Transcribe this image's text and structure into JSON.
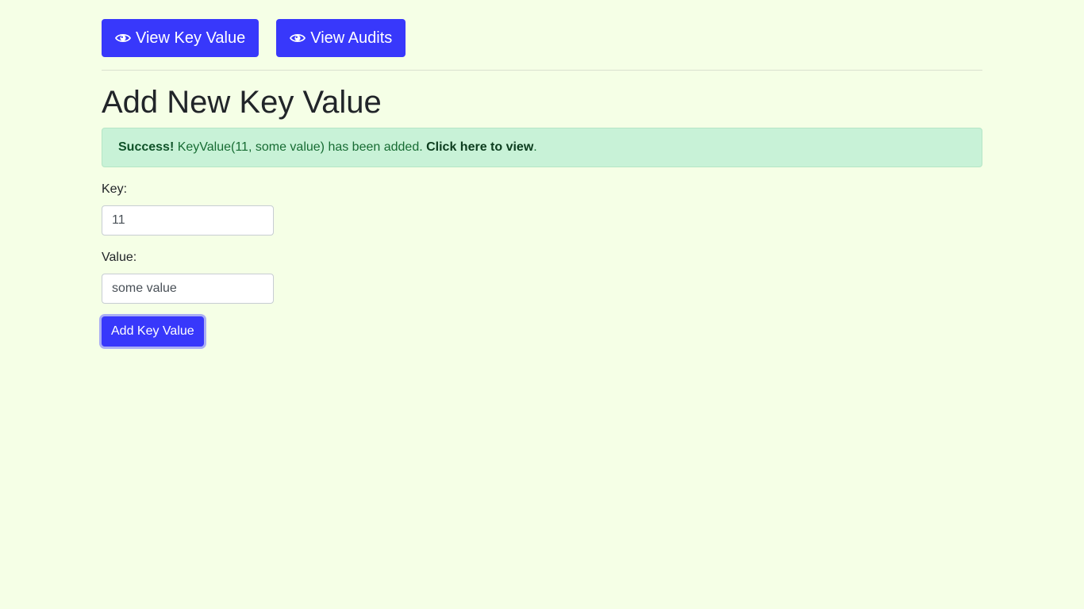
{
  "nav": {
    "view_key_value_label": "View Key Value",
    "view_audits_label": "View Audits",
    "icon": "eye-icon"
  },
  "page": {
    "title": "Add New Key Value"
  },
  "alert": {
    "prefix": "Success!",
    "message": " KeyValue(11, some value) has been added. ",
    "link_text": "Click here to view",
    "suffix": "."
  },
  "form": {
    "key_label": "Key:",
    "key_value": "11",
    "value_label": "Value:",
    "value_value": "some value",
    "submit_label": "Add Key Value"
  },
  "colors": {
    "background": "#f5ffe6",
    "primary": "#3838fb",
    "success_bg": "#c8f2d7",
    "success_text": "#176c33"
  }
}
